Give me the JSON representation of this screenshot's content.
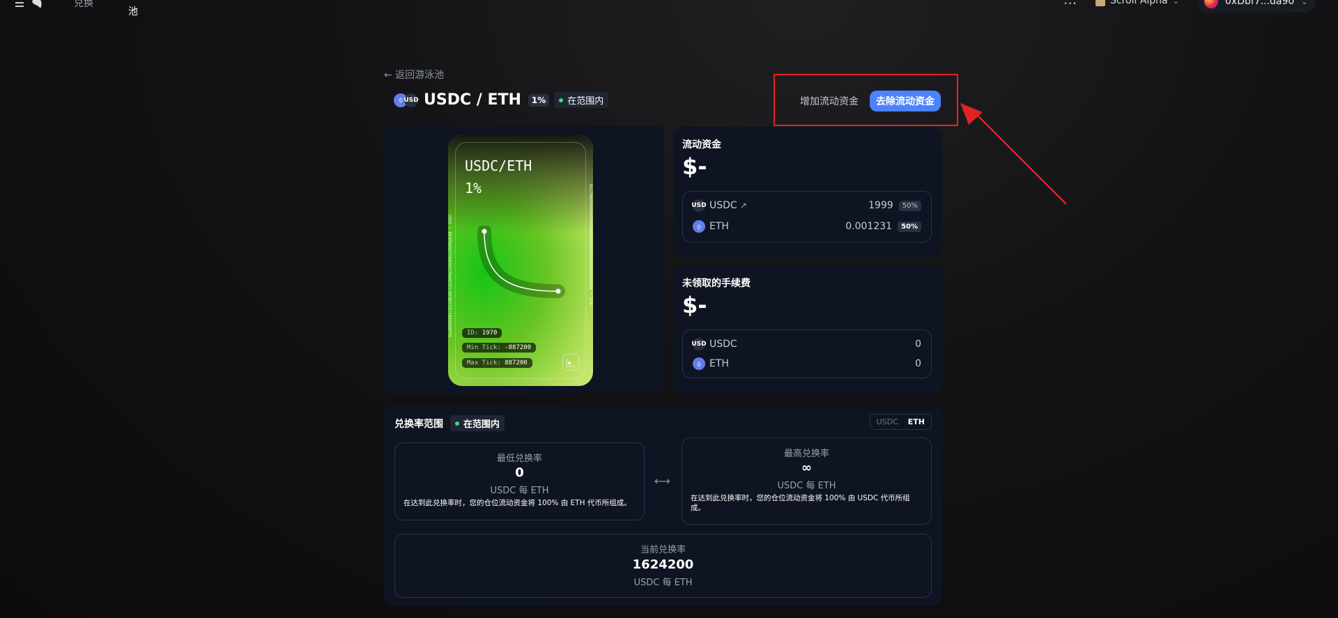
{
  "nav": {
    "swap": "兑换",
    "pool": "池",
    "more": "···",
    "chain": "Scroll Alpha",
    "wallet": "0xDbf7...da90"
  },
  "page": {
    "back": "← 返回游泳池",
    "token_eth": "⬨",
    "token_usd": "USD",
    "pair": "USDC / ETH",
    "fee": "1%",
    "status": "在范围内",
    "add_liquidity": "增加流动资金",
    "remove_liquidity": "去除流动资金",
    "annotation_color": "#e22222"
  },
  "nft": {
    "title_line1": "USDC/ETH",
    "title_line2": "1%",
    "side_left": "0xa0b86991c6218b36c1d19d4a2e9eb0ce3606eb48 • USDC",
    "side_right": "0x5300000000000000000000000000000000000004 • ETH",
    "id_label": "ID:",
    "id": "1970",
    "min_tick_label": "Min Tick:",
    "min_tick": "-887200",
    "max_tick_label": "Max Tick:",
    "max_tick": "887200"
  },
  "liquidity": {
    "title": "流动资金",
    "amount": "$-",
    "rows": [
      {
        "token": "USDC",
        "icon": "USD",
        "value": "1999",
        "pct": "50%"
      },
      {
        "token": "ETH",
        "icon": "⬨",
        "value": "0.001231",
        "pct": "50%"
      }
    ]
  },
  "fees": {
    "title": "未领取的手续费",
    "amount": "$-",
    "rows": [
      {
        "token": "USDC",
        "icon": "USD",
        "value": "0"
      },
      {
        "token": "ETH",
        "icon": "⬨",
        "value": "0"
      }
    ]
  },
  "range": {
    "title": "兑换率范围",
    "status": "在范围内",
    "toggle": [
      "USDC",
      "ETH"
    ],
    "toggle_selected": "ETH",
    "min": {
      "label": "最低兑换率",
      "value": "0",
      "unit": "USDC 每 ETH",
      "note": "在达到此兑换率时，您的仓位流动资金将 100% 由 ETH 代币所组成。"
    },
    "max": {
      "label": "最高兑换率",
      "value": "∞",
      "unit": "USDC 每 ETH",
      "note": "在达到此兑换率时，您的仓位流动资金将 100% 由 USDC 代币所组成。"
    },
    "arrow": "⟷",
    "current": {
      "label": "当前兑换率",
      "value": "1624200",
      "unit": "USDC 每 ETH"
    }
  }
}
